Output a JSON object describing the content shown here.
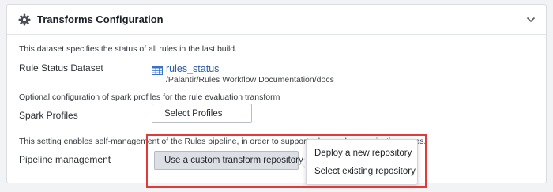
{
  "panel": {
    "title": "Transforms Configuration"
  },
  "rule_status": {
    "description": "This dataset specifies the status of all rules in the last build.",
    "label": "Rule Status Dataset",
    "dataset_name": "rules_status",
    "dataset_path": "/Palantir/Rules Workflow Documentation/docs"
  },
  "spark": {
    "description": "Optional configuration of spark profiles for the rule evaluation transform",
    "label": "Spark Profiles",
    "select_placeholder": "Select Profiles"
  },
  "pipeline": {
    "description": "This setting enables self-management of the Rules pipeline, in order to support advanced customization cases.",
    "label": "Pipeline management",
    "button_label": "Use a custom transform repository",
    "menu_items": [
      {
        "label": "Deploy a new repository"
      },
      {
        "label": "Select existing repository"
      }
    ]
  },
  "icons": {
    "header": "gear-icon",
    "collapse": "chevron-down-icon",
    "dataset": "table-icon"
  },
  "colors": {
    "link": "#2d5ea3",
    "highlight": "#e03a3a"
  }
}
